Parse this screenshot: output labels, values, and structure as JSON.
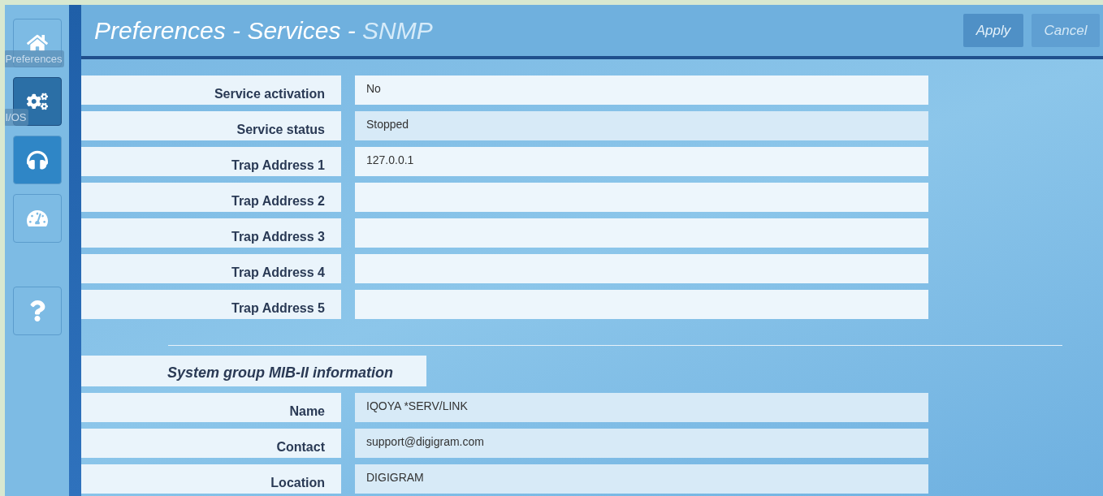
{
  "sidebar": {
    "items": [
      {
        "kind": "home",
        "selected": false,
        "hover": false,
        "tooltip": "Preferences"
      },
      {
        "kind": "gears",
        "selected": true,
        "hover": false,
        "tooltip": "I/OS"
      },
      {
        "kind": "headphones",
        "selected": false,
        "hover": true
      },
      {
        "kind": "gauge",
        "selected": false,
        "hover": false
      },
      {
        "kind": "help",
        "selected": false,
        "hover": false
      }
    ]
  },
  "header": {
    "title": "Preferences - Services - ",
    "subtitle": "SNMP",
    "buttons": [
      {
        "label": "Apply",
        "disabled": false
      },
      {
        "label": "Cancel",
        "disabled": true
      }
    ]
  },
  "fields": [
    {
      "label": "Service activation",
      "value": "No",
      "readonly": false
    },
    {
      "label": "Service status",
      "value": "Stopped",
      "readonly": true
    },
    {
      "label": "Trap Address 1",
      "value": "127.0.0.1",
      "readonly": false
    },
    {
      "label": "Trap Address 2",
      "readonly": false
    },
    {
      "label": "Trap Address 3",
      "readonly": false
    },
    {
      "label": "Trap Address 4",
      "readonly": false
    },
    {
      "label": "Trap Address 5",
      "readonly": false
    }
  ],
  "section": {
    "title": "System group MIB-II information",
    "fields": [
      {
        "label": "Name",
        "value": "IQOYA *SERV/LINK",
        "readonly": true
      },
      {
        "label": "Contact",
        "value": "support@digigram.com",
        "readonly": true
      },
      {
        "label": "Location",
        "value": "DIGIGRAM",
        "readonly": true
      }
    ]
  }
}
